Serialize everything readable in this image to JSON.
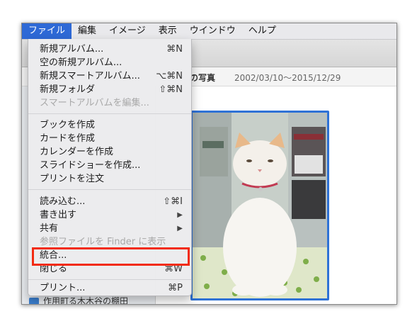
{
  "menubar": {
    "items": [
      "ファイル",
      "編集",
      "イメージ",
      "表示",
      "ウインドウ",
      "ヘルプ"
    ]
  },
  "infobar": {
    "title": "の写真",
    "date_range": "2002/03/10〜2015/12/29"
  },
  "sidebar": {
    "bottom_item": "作用町る木木谷の棚田"
  },
  "file_menu": {
    "new_album": {
      "label": "新規アルバム...",
      "shortcut": "⌘N"
    },
    "new_empty_album": {
      "label": "空の新規アルバム..."
    },
    "new_smart_album": {
      "label": "新規スマートアルバム...",
      "shortcut": "⌥⌘N"
    },
    "new_folder": {
      "label": "新規フォルダ",
      "shortcut": "⇧⌘N"
    },
    "edit_smart_album": {
      "label": "スマートアルバムを編集..."
    },
    "create_book": {
      "label": "ブックを作成"
    },
    "create_card": {
      "label": "カードを作成"
    },
    "create_calendar": {
      "label": "カレンダーを作成"
    },
    "create_slideshow": {
      "label": "スライドショーを作成..."
    },
    "order_prints": {
      "label": "プリントを注文"
    },
    "import": {
      "label": "読み込む...",
      "shortcut": "⇧⌘I"
    },
    "export": {
      "label": "書き出す"
    },
    "share": {
      "label": "共有"
    },
    "show_in_finder": {
      "label": "参照ファイルを Finder に表示"
    },
    "merge": {
      "label": "統合..."
    },
    "close": {
      "label": "閉じる",
      "shortcut": "⌘W"
    },
    "print": {
      "label": "プリント...",
      "shortcut": "⌘P"
    }
  },
  "icons": {
    "submenu_arrow": "▶"
  },
  "colors": {
    "menu_active": "#2e69d6",
    "highlight_box": "#f22b12",
    "photo_selection": "#2f72d6"
  }
}
